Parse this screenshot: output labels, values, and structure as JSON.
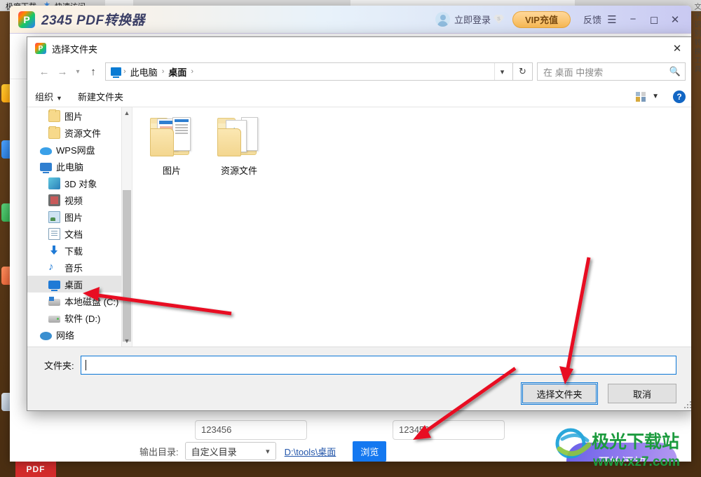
{
  "browser": {
    "bookmark1": "极度下载",
    "bookmark2": "快速访问"
  },
  "app": {
    "title": "2345 PDF转换器",
    "login": "立即登录",
    "vip": "VIP充值",
    "feedback": "反馈",
    "menu_icon": "hamburger-icon",
    "minimize_icon": "minimize-icon",
    "maximize_icon": "maximize-icon",
    "close_icon": "close-icon",
    "start_button": "开始添加",
    "output_label": "输出目录:",
    "output_select": "自定义目录",
    "output_path": "D:\\tools\\桌面",
    "browse_button": "浏览",
    "bg_field_left": "123456",
    "bg_field_right": "123456"
  },
  "dialog": {
    "title": "选择文件夹",
    "close_icon": "close-icon",
    "nav": {
      "back_icon": "arrow-left-icon",
      "forward_icon": "arrow-right-icon",
      "recent_icon": "chevron-down-icon",
      "up_icon": "arrow-up-icon",
      "refresh_icon": "refresh-icon",
      "crumbs": [
        "此电脑",
        "桌面"
      ],
      "crumb_dropdown_icon": "chevron-down-icon"
    },
    "search": {
      "placeholder": "在 桌面 中搜索",
      "icon": "search-icon"
    },
    "toolbar": {
      "organize": "组织",
      "new_folder": "新建文件夹",
      "view_icon": "view-tiles-icon",
      "view_caret_icon": "chevron-down-icon",
      "help_icon": "help-icon"
    },
    "tree": [
      {
        "label": "图片",
        "icon": "folder-icon",
        "indent": 2,
        "selected": false
      },
      {
        "label": "资源文件",
        "icon": "folder-icon",
        "indent": 2,
        "selected": false
      },
      {
        "label": "WPS网盘",
        "icon": "cloud-icon",
        "indent": 1,
        "selected": false
      },
      {
        "label": "此电脑",
        "icon": "pc-icon",
        "indent": 1,
        "selected": false
      },
      {
        "label": "3D 对象",
        "icon": "3d-icon",
        "indent": 2,
        "selected": false
      },
      {
        "label": "视频",
        "icon": "video-icon",
        "indent": 2,
        "selected": false
      },
      {
        "label": "图片",
        "icon": "picture-icon",
        "indent": 2,
        "selected": false
      },
      {
        "label": "文档",
        "icon": "document-icon",
        "indent": 2,
        "selected": false
      },
      {
        "label": "下载",
        "icon": "download-icon",
        "indent": 2,
        "selected": false
      },
      {
        "label": "音乐",
        "icon": "music-icon",
        "indent": 2,
        "selected": false
      },
      {
        "label": "桌面",
        "icon": "desktop-icon",
        "indent": 2,
        "selected": true
      },
      {
        "label": "本地磁盘 (C:)",
        "icon": "drive-c-icon",
        "indent": 2,
        "selected": false
      },
      {
        "label": "软件 (D:)",
        "icon": "drive-icon",
        "indent": 2,
        "selected": false
      },
      {
        "label": "网络",
        "icon": "network-icon",
        "indent": 1,
        "selected": false
      }
    ],
    "files": [
      {
        "name": "图片",
        "icon": "folder-images-icon"
      },
      {
        "name": "资源文件",
        "icon": "folder-mp3-icon"
      }
    ],
    "folder_label": "文件夹:",
    "folder_value": "",
    "select_button": "选择文件夹",
    "cancel_button": "取消"
  },
  "watermark": {
    "cn": "极光下载站",
    "url": "www.xz7.com"
  },
  "taskbar": {
    "pdf": "PDF"
  },
  "colors": {
    "accent_blue": "#0a76d6",
    "annotation_red": "#e81123",
    "vip_orange": "#f7b955",
    "start_purple": "#8f79ee"
  }
}
